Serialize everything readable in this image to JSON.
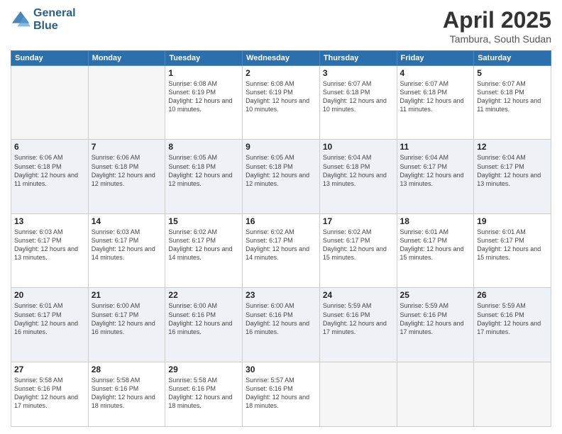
{
  "header": {
    "logo_general": "General",
    "logo_blue": "Blue",
    "month_title": "April 2025",
    "location": "Tambura, South Sudan"
  },
  "days_of_week": [
    "Sunday",
    "Monday",
    "Tuesday",
    "Wednesday",
    "Thursday",
    "Friday",
    "Saturday"
  ],
  "weeks": [
    [
      {
        "num": "",
        "sunrise": "",
        "sunset": "",
        "daylight": ""
      },
      {
        "num": "",
        "sunrise": "",
        "sunset": "",
        "daylight": ""
      },
      {
        "num": "1",
        "sunrise": "Sunrise: 6:08 AM",
        "sunset": "Sunset: 6:19 PM",
        "daylight": "Daylight: 12 hours and 10 minutes."
      },
      {
        "num": "2",
        "sunrise": "Sunrise: 6:08 AM",
        "sunset": "Sunset: 6:19 PM",
        "daylight": "Daylight: 12 hours and 10 minutes."
      },
      {
        "num": "3",
        "sunrise": "Sunrise: 6:07 AM",
        "sunset": "Sunset: 6:18 PM",
        "daylight": "Daylight: 12 hours and 10 minutes."
      },
      {
        "num": "4",
        "sunrise": "Sunrise: 6:07 AM",
        "sunset": "Sunset: 6:18 PM",
        "daylight": "Daylight: 12 hours and 11 minutes."
      },
      {
        "num": "5",
        "sunrise": "Sunrise: 6:07 AM",
        "sunset": "Sunset: 6:18 PM",
        "daylight": "Daylight: 12 hours and 11 minutes."
      }
    ],
    [
      {
        "num": "6",
        "sunrise": "Sunrise: 6:06 AM",
        "sunset": "Sunset: 6:18 PM",
        "daylight": "Daylight: 12 hours and 11 minutes."
      },
      {
        "num": "7",
        "sunrise": "Sunrise: 6:06 AM",
        "sunset": "Sunset: 6:18 PM",
        "daylight": "Daylight: 12 hours and 12 minutes."
      },
      {
        "num": "8",
        "sunrise": "Sunrise: 6:05 AM",
        "sunset": "Sunset: 6:18 PM",
        "daylight": "Daylight: 12 hours and 12 minutes."
      },
      {
        "num": "9",
        "sunrise": "Sunrise: 6:05 AM",
        "sunset": "Sunset: 6:18 PM",
        "daylight": "Daylight: 12 hours and 12 minutes."
      },
      {
        "num": "10",
        "sunrise": "Sunrise: 6:04 AM",
        "sunset": "Sunset: 6:18 PM",
        "daylight": "Daylight: 12 hours and 13 minutes."
      },
      {
        "num": "11",
        "sunrise": "Sunrise: 6:04 AM",
        "sunset": "Sunset: 6:17 PM",
        "daylight": "Daylight: 12 hours and 13 minutes."
      },
      {
        "num": "12",
        "sunrise": "Sunrise: 6:04 AM",
        "sunset": "Sunset: 6:17 PM",
        "daylight": "Daylight: 12 hours and 13 minutes."
      }
    ],
    [
      {
        "num": "13",
        "sunrise": "Sunrise: 6:03 AM",
        "sunset": "Sunset: 6:17 PM",
        "daylight": "Daylight: 12 hours and 13 minutes."
      },
      {
        "num": "14",
        "sunrise": "Sunrise: 6:03 AM",
        "sunset": "Sunset: 6:17 PM",
        "daylight": "Daylight: 12 hours and 14 minutes."
      },
      {
        "num": "15",
        "sunrise": "Sunrise: 6:02 AM",
        "sunset": "Sunset: 6:17 PM",
        "daylight": "Daylight: 12 hours and 14 minutes."
      },
      {
        "num": "16",
        "sunrise": "Sunrise: 6:02 AM",
        "sunset": "Sunset: 6:17 PM",
        "daylight": "Daylight: 12 hours and 14 minutes."
      },
      {
        "num": "17",
        "sunrise": "Sunrise: 6:02 AM",
        "sunset": "Sunset: 6:17 PM",
        "daylight": "Daylight: 12 hours and 15 minutes."
      },
      {
        "num": "18",
        "sunrise": "Sunrise: 6:01 AM",
        "sunset": "Sunset: 6:17 PM",
        "daylight": "Daylight: 12 hours and 15 minutes."
      },
      {
        "num": "19",
        "sunrise": "Sunrise: 6:01 AM",
        "sunset": "Sunset: 6:17 PM",
        "daylight": "Daylight: 12 hours and 15 minutes."
      }
    ],
    [
      {
        "num": "20",
        "sunrise": "Sunrise: 6:01 AM",
        "sunset": "Sunset: 6:17 PM",
        "daylight": "Daylight: 12 hours and 16 minutes."
      },
      {
        "num": "21",
        "sunrise": "Sunrise: 6:00 AM",
        "sunset": "Sunset: 6:17 PM",
        "daylight": "Daylight: 12 hours and 16 minutes."
      },
      {
        "num": "22",
        "sunrise": "Sunrise: 6:00 AM",
        "sunset": "Sunset: 6:16 PM",
        "daylight": "Daylight: 12 hours and 16 minutes."
      },
      {
        "num": "23",
        "sunrise": "Sunrise: 6:00 AM",
        "sunset": "Sunset: 6:16 PM",
        "daylight": "Daylight: 12 hours and 16 minutes."
      },
      {
        "num": "24",
        "sunrise": "Sunrise: 5:59 AM",
        "sunset": "Sunset: 6:16 PM",
        "daylight": "Daylight: 12 hours and 17 minutes."
      },
      {
        "num": "25",
        "sunrise": "Sunrise: 5:59 AM",
        "sunset": "Sunset: 6:16 PM",
        "daylight": "Daylight: 12 hours and 17 minutes."
      },
      {
        "num": "26",
        "sunrise": "Sunrise: 5:59 AM",
        "sunset": "Sunset: 6:16 PM",
        "daylight": "Daylight: 12 hours and 17 minutes."
      }
    ],
    [
      {
        "num": "27",
        "sunrise": "Sunrise: 5:58 AM",
        "sunset": "Sunset: 6:16 PM",
        "daylight": "Daylight: 12 hours and 17 minutes."
      },
      {
        "num": "28",
        "sunrise": "Sunrise: 5:58 AM",
        "sunset": "Sunset: 6:16 PM",
        "daylight": "Daylight: 12 hours and 18 minutes."
      },
      {
        "num": "29",
        "sunrise": "Sunrise: 5:58 AM",
        "sunset": "Sunset: 6:16 PM",
        "daylight": "Daylight: 12 hours and 18 minutes."
      },
      {
        "num": "30",
        "sunrise": "Sunrise: 5:57 AM",
        "sunset": "Sunset: 6:16 PM",
        "daylight": "Daylight: 12 hours and 18 minutes."
      },
      {
        "num": "",
        "sunrise": "",
        "sunset": "",
        "daylight": ""
      },
      {
        "num": "",
        "sunrise": "",
        "sunset": "",
        "daylight": ""
      },
      {
        "num": "",
        "sunrise": "",
        "sunset": "",
        "daylight": ""
      }
    ]
  ]
}
